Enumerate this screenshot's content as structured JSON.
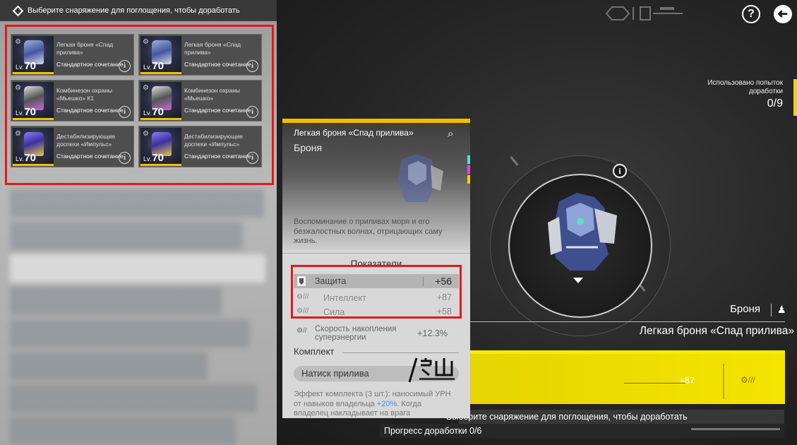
{
  "left_panel": {
    "header": "Выберите снаряжение для поглощения, чтобы доработать",
    "items": [
      {
        "name": "Легкая броня «Спад прилива»",
        "level_prefix": "Lv.",
        "level": "70",
        "tag": "Стандартное сочетание"
      },
      {
        "name": "Легкая броня «Спад прилива»",
        "level_prefix": "Lv.",
        "level": "70",
        "tag": "Стандартное сочетание"
      },
      {
        "name": "Комбинезон охраны «Мьешко» К1",
        "level_prefix": "Lv.",
        "level": "70",
        "tag": "Стандартное сочетание"
      },
      {
        "name": "Комбинезон охраны «Мьешко»",
        "level_prefix": "Lv.",
        "level": "70",
        "tag": "Стандартное сочетание"
      },
      {
        "name": "Дестабилизирующие доспехи «Импульс»",
        "level_prefix": "Lv.",
        "level": "70",
        "tag": "Стандартное сочетание"
      },
      {
        "name": "Дестабилизирующие доспехи «Импульс»",
        "level_prefix": "Lv.",
        "level": "70",
        "tag": "Стандартное сочетание"
      }
    ]
  },
  "top": {
    "help_label": "?",
    "back_label": "➜"
  },
  "attempts": {
    "label": "Использовано попыток доработки",
    "value": "0/9"
  },
  "detail_card": {
    "name": "Легкая броня «Спад прилива»",
    "category": "Броня",
    "description": "Воспоминание о приливах моря и его безжалостных волнах, отрицающих саму жизнь.",
    "section_title": "Показатели",
    "stats": [
      {
        "name": "Защита",
        "value": "+56"
      },
      {
        "name": "Интеллект",
        "value": "+87"
      },
      {
        "name": "Сила",
        "value": "+58"
      }
    ],
    "energy_stat": {
      "name": "Скорость накопления суперэнергии",
      "value": "+12.3%"
    },
    "set_label": "Комплект",
    "set_name": "Натиск прилива",
    "set_desc_prefix": "Эффект комплекта (3 шт.): наносимый УРН от навыков владельца ",
    "set_desc_highlight": "+20%",
    "set_desc_suffix": ". Когда владелец накладывает на врага"
  },
  "main": {
    "category": "Броня",
    "item_title": "Легкая броня «Спад прилива»",
    "panel_value": "+87",
    "hint": "Выберите снаряжение для поглощения, чтобы доработать",
    "progress": "Прогресс доработки  0/6"
  },
  "colors": {
    "accent_yellow": "#f5e400",
    "highlight_red": "#e11a1a",
    "link_blue": "#4a8de0"
  }
}
